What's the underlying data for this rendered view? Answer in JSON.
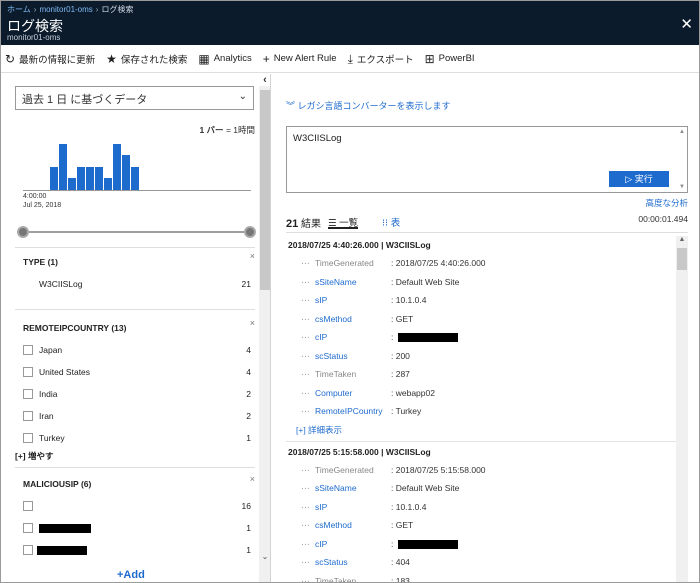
{
  "breadcrumb": {
    "home": "ホーム",
    "sep": "›",
    "workspace": "monitor01-oms",
    "current": "ログ検索"
  },
  "header": {
    "title": "ログ検索",
    "subtitle": "monitor01-oms",
    "close": "✕"
  },
  "toolbar": {
    "refresh": "最新の情報に更新",
    "saved_searches": "保存された検索",
    "analytics": "Analytics",
    "new_alert_rule": "New Alert Rule",
    "export": "エクスポート",
    "powerbi": "PowerBI"
  },
  "left": {
    "time_range": "過去 1 日 に基づくデータ",
    "bar_scale_bar": "1 バー",
    "bar_scale_rest": "= 1時間",
    "histogram": {
      "time_label": "4:00:00",
      "date_label": "Jul 25, 2018",
      "values": [
        0,
        0,
        0,
        2,
        4,
        1,
        2,
        2,
        2,
        1,
        4,
        3,
        2
      ]
    },
    "facets": {
      "type": {
        "title": "TYPE",
        "count": "(1)",
        "items": [
          {
            "label": "W3CIISLog",
            "count": "21"
          }
        ]
      },
      "remoteip": {
        "title": "REMOTEIPCOUNTRY",
        "count": "(13)",
        "items": [
          {
            "label": "Japan",
            "count": "4"
          },
          {
            "label": "United States",
            "count": "4"
          },
          {
            "label": "India",
            "count": "2"
          },
          {
            "label": "Iran",
            "count": "2"
          },
          {
            "label": "Turkey",
            "count": "1"
          }
        ],
        "more": "[+] 増やす"
      },
      "malicious": {
        "title": "MALICIOUSIP",
        "count": "(6)",
        "items": [
          {
            "label": "",
            "count": "16"
          },
          {
            "label": "",
            "count": "1"
          },
          {
            "label": "",
            "count": "1"
          }
        ]
      }
    },
    "add_button": "+Add",
    "close_facet": "×"
  },
  "right": {
    "legacy_link": "レガシ言語コンバーターを表示します",
    "query": "W3CIISLog",
    "run_button": "実行",
    "advanced_link": "高度な分析",
    "results_number": "21",
    "results_label": "結果",
    "view_list": "一覧",
    "view_table": "表",
    "elapsed": "00:00:01.494",
    "details_link": "[+] 詳細表示",
    "records": [
      {
        "header": "2018/07/25 4:40:26.000 | W3CIISLog",
        "fields": [
          {
            "key": "TimeGenerated",
            "value": ": 2018/07/25 4:40:26.000",
            "grey": true
          },
          {
            "key": "sSiteName",
            "value": ": Default Web Site"
          },
          {
            "key": "sIP",
            "value": ": 10.1.0.4"
          },
          {
            "key": "csMethod",
            "value": ": GET"
          },
          {
            "key": "cIP",
            "value": ":",
            "redacted": true
          },
          {
            "key": "scStatus",
            "value": ": 200"
          },
          {
            "key": "TimeTaken",
            "value": ": 287",
            "grey": true
          },
          {
            "key": "Computer",
            "value": ": webapp02"
          },
          {
            "key": "RemoteIPCountry",
            "value": ": Turkey"
          }
        ]
      },
      {
        "header": "2018/07/25 5:15:58.000 | W3CIISLog",
        "fields": [
          {
            "key": "TimeGenerated",
            "value": ": 2018/07/25 5:15:58.000",
            "grey": true
          },
          {
            "key": "sSiteName",
            "value": ": Default Web Site"
          },
          {
            "key": "sIP",
            "value": ": 10.1.0.4"
          },
          {
            "key": "csMethod",
            "value": ": GET"
          },
          {
            "key": "cIP",
            "value": ":",
            "redacted": true
          },
          {
            "key": "scStatus",
            "value": ": 404"
          },
          {
            "key": "TimeTaken",
            "value": ": 183",
            "grey": true
          }
        ]
      }
    ]
  },
  "colors": {
    "header_bg": "#0b1b2c",
    "accent": "#1e6bce",
    "bar": "#1e6bce"
  }
}
